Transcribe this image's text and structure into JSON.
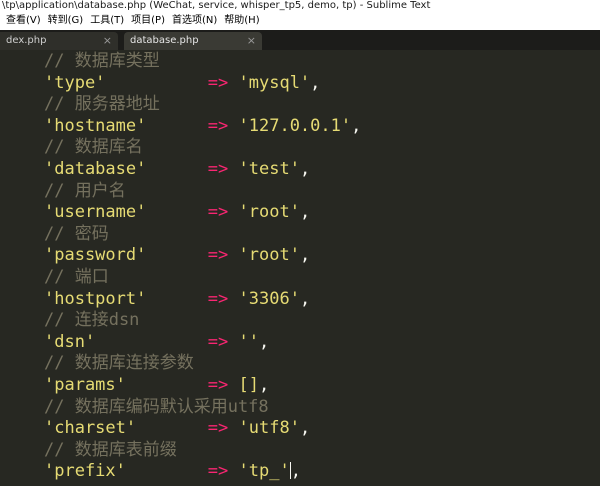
{
  "window": {
    "title": "\\tp\\application\\database.php (WeChat, service, whisper_tp5, demo, tp) - Sublime Text"
  },
  "menu": [
    {
      "label": "查看(V)"
    },
    {
      "label": "转到(G)"
    },
    {
      "label": "工具(T)"
    },
    {
      "label": "项目(P)"
    },
    {
      "label": "首选项(N)"
    },
    {
      "label": "帮助(H)"
    }
  ],
  "tabs": [
    {
      "label": "dex.php",
      "close": "×"
    },
    {
      "label": "database.php",
      "close": "×"
    }
  ],
  "editor": {
    "code": [
      {
        "comment": "// 数据库类型"
      },
      {
        "key": "'type'",
        "pad": "          ",
        "op": "=>",
        "value": "'mysql'",
        "end": ","
      },
      {
        "comment": "// 服务器地址"
      },
      {
        "key": "'hostname'",
        "pad": "      ",
        "op": "=>",
        "value": "'127.0.0.1'",
        "end": ","
      },
      {
        "comment": "// 数据库名"
      },
      {
        "key": "'database'",
        "pad": "      ",
        "op": "=>",
        "value": "'test'",
        "end": ","
      },
      {
        "comment": "// 用户名"
      },
      {
        "key": "'username'",
        "pad": "      ",
        "op": "=>",
        "value": "'root'",
        "end": ","
      },
      {
        "comment": "// 密码"
      },
      {
        "key": "'password'",
        "pad": "      ",
        "op": "=>",
        "value": "'root'",
        "end": ","
      },
      {
        "comment": "// 端口"
      },
      {
        "key": "'hostport'",
        "pad": "      ",
        "op": "=>",
        "value": "'3306'",
        "end": ","
      },
      {
        "comment": "// 连接dsn"
      },
      {
        "key": "'dsn'",
        "pad": "           ",
        "op": "=>",
        "value": "''",
        "end": ","
      },
      {
        "comment": "// 数据库连接参数"
      },
      {
        "key": "'params'",
        "pad": "        ",
        "op": "=>",
        "value": "[]",
        "end": ","
      },
      {
        "comment": "// 数据库编码默认采用utf8"
      },
      {
        "key": "'charset'",
        "pad": "       ",
        "op": "=>",
        "value": "'utf8'",
        "end": ","
      },
      {
        "comment": "// 数据库表前缀"
      },
      {
        "key": "'prefix'",
        "pad": "        ",
        "op": "=>",
        "value": "'tp_'",
        "end": ",",
        "cursor": true
      }
    ]
  },
  "colors": {
    "background": "#272822",
    "comment": "#75715E",
    "string": "#E6DB74",
    "operator": "#F92672",
    "punctuation": "#F8F8F2"
  }
}
